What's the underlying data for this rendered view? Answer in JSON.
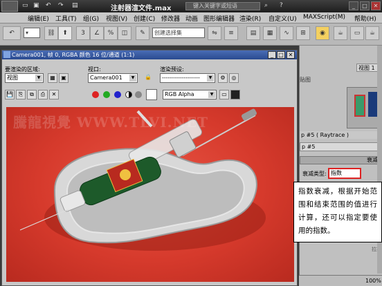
{
  "app": {
    "title": "注射器渲文件.max",
    "search_placeholder": "键入关键字或短语"
  },
  "menu": [
    "编辑(E)",
    "工具(T)",
    "组(G)",
    "视图(V)",
    "创建(C)",
    "修改器",
    "动画",
    "图形编辑器",
    "渲染(R)",
    "自定义(U)",
    "MAXScript(M)",
    "帮助(H)"
  ],
  "toolbar": {
    "selection_set_placeholder": "创建选择集"
  },
  "render_window": {
    "title": "Camera001, 帧 0, RGBA 颜色 16 位/通道 (1:1)",
    "area_label": "要渲染的区域:",
    "area_value": "视图",
    "viewport_label": "视口:",
    "viewport_value": "Camera001",
    "preset_label": "渲染预设:",
    "preset_value": "-------------------",
    "channel_value": "RGB Alpha",
    "watermark": "騰龍視覺 WWW.TLVI.NET"
  },
  "command_panel": {
    "viewport_field": "视图 1",
    "panel_tab": "贴图",
    "map_title": "p #5 ( Raytrace )",
    "map_name": "p #5",
    "rollout_decay": "衰减",
    "decay_type_label": "衰减类型:",
    "decay_type_value": "指数",
    "status_zoom": "100%",
    "partial_label": "拉扣"
  },
  "callout": {
    "text": "指数衰减，根据开始范围和结束范围的值进行计算，还可以指定要使用的指数。"
  },
  "colors": {
    "render_bg": "#d63a2c",
    "title_bar": "#2a4a90",
    "highlight": "#dd2222"
  }
}
